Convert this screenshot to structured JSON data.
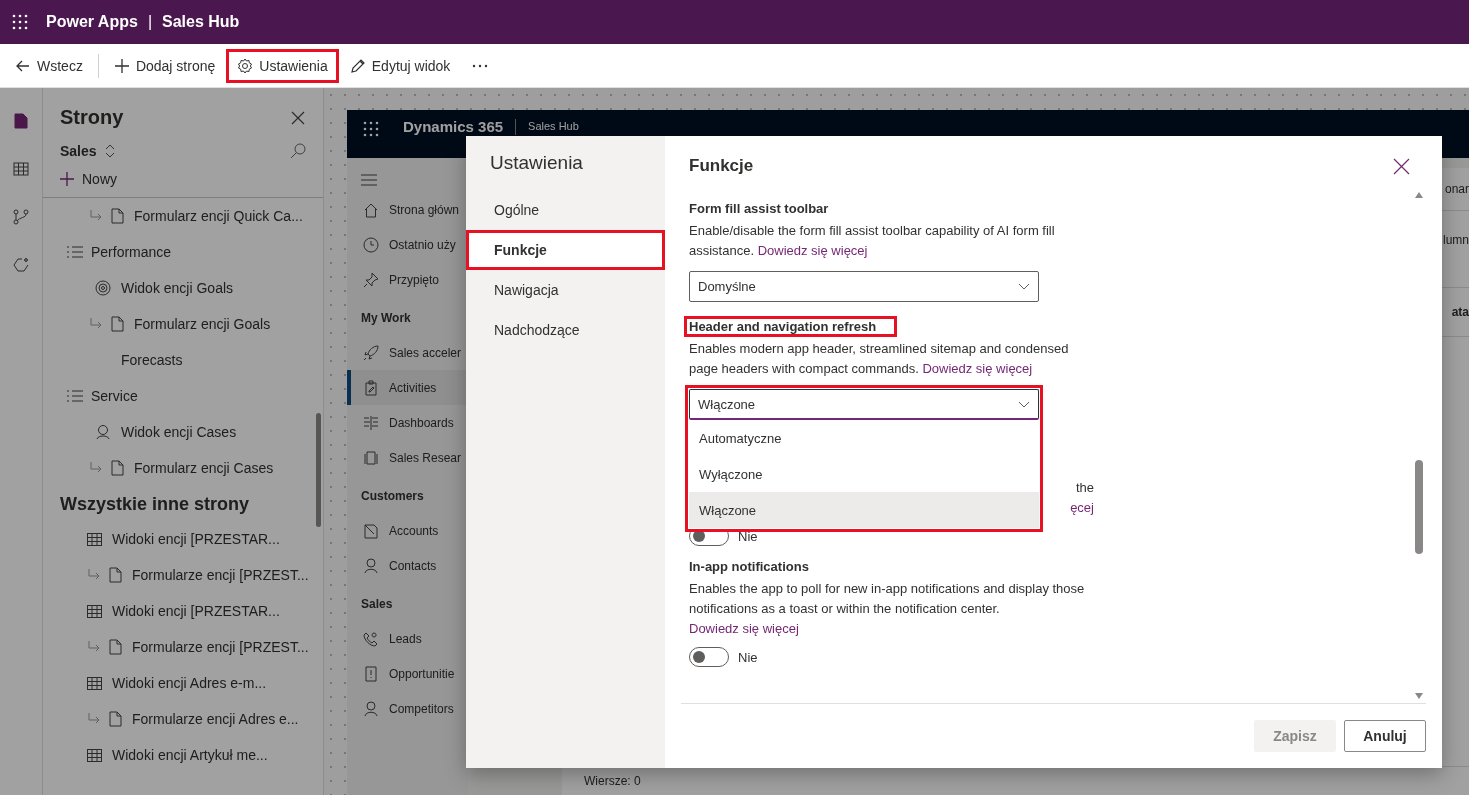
{
  "app_bar": {
    "title": "Power Apps",
    "separator": "|",
    "app": "Sales Hub"
  },
  "toolbar": [
    {
      "kind": "back",
      "label": "Wstecz",
      "highlighted": false
    },
    {
      "kind": "add",
      "label": "Dodaj stronę",
      "highlighted": false
    },
    {
      "kind": "settings",
      "label": "Ustawienia",
      "highlighted": true
    },
    {
      "kind": "edit",
      "label": "Edytuj widok",
      "highlighted": false
    },
    {
      "kind": "more",
      "highlighted": false
    }
  ],
  "rail": [
    {
      "kind": "page",
      "selected": true
    },
    {
      "kind": "table",
      "selected": false
    },
    {
      "kind": "flow",
      "selected": false
    },
    {
      "kind": "copilot",
      "selected": false
    }
  ],
  "pages_panel": {
    "title": "Strony",
    "area": "Sales",
    "new_button": "Nowy",
    "tree": [
      {
        "kind": "form",
        "label": "Formularz encji Quick Ca..."
      },
      {
        "kind": "group",
        "label": "Performance",
        "children": [
          {
            "kind": "target",
            "label": "Widok encji Goals"
          },
          {
            "kind": "form",
            "label": "Formularz encji Goals"
          },
          {
            "kind": "plain",
            "label": "Forecasts"
          }
        ]
      },
      {
        "kind": "group",
        "label": "Service",
        "children": [
          {
            "kind": "person",
            "label": "Widok encji Cases"
          },
          {
            "kind": "form",
            "label": "Formularz encji Cases"
          }
        ]
      }
    ],
    "other_title": "Wszystkie inne strony",
    "other": [
      {
        "kind": "grid",
        "label": "Widoki encji [PRZESTAR..."
      },
      {
        "kind": "form",
        "label": "Formularze encji [PRZEST..."
      },
      {
        "kind": "grid",
        "label": "Widoki encji [PRZESTAR..."
      },
      {
        "kind": "form",
        "label": "Formularze encji [PRZEST..."
      },
      {
        "kind": "grid",
        "label": "Widoki encji Adres e-m..."
      },
      {
        "kind": "form",
        "label": "Formularze encji Adres e..."
      },
      {
        "kind": "grid",
        "label": "Widoki encji Artykuł me..."
      }
    ]
  },
  "preview": {
    "brand": "Dynamics 365",
    "app": "Sales Hub",
    "nav": [
      {
        "kind": "menu"
      },
      {
        "kind": "home",
        "label": "Strona główn",
        "selected": false
      },
      {
        "kind": "clock",
        "label": "Ostatnio uży",
        "selected": false
      },
      {
        "kind": "pin",
        "label": "Przypięto",
        "selected": false
      },
      {
        "kind": "heading",
        "label": "My Work"
      },
      {
        "kind": "rocket",
        "label": "Sales acceler",
        "selected": false
      },
      {
        "kind": "clipboard",
        "label": "Activities",
        "selected": true
      },
      {
        "kind": "bars",
        "label": "Dashboards",
        "selected": false
      },
      {
        "kind": "pages",
        "label": "Sales Resear",
        "selected": false
      },
      {
        "kind": "heading",
        "label": "Customers"
      },
      {
        "kind": "folder",
        "label": "Accounts",
        "selected": false
      },
      {
        "kind": "person",
        "label": "Contacts",
        "selected": false
      },
      {
        "kind": "heading",
        "label": "Sales"
      },
      {
        "kind": "phone",
        "label": "Leads",
        "selected": false
      },
      {
        "kind": "alert",
        "label": "Opportunitie",
        "selected": false
      },
      {
        "kind": "person",
        "label": "Competitors",
        "selected": false
      }
    ],
    "fragments": [
      "onar",
      "lumn",
      "ata"
    ],
    "footer": "Wiersze: 0"
  },
  "dialog": {
    "title": "Ustawienia",
    "tabs": [
      {
        "label": "Ogólne",
        "selected": false,
        "highlighted": false
      },
      {
        "label": "Funkcje",
        "selected": true,
        "highlighted": true
      },
      {
        "label": "Nawigacja",
        "selected": false,
        "highlighted": false
      },
      {
        "label": "Nadchodzące",
        "selected": false,
        "highlighted": false
      }
    ],
    "heading": "Funkcje",
    "sections": [
      {
        "kind": "select",
        "title": "Form fill assist toolbar",
        "title_highlighted": false,
        "description": "Enable/disable the form fill assist toolbar capability of AI form fill assistance.",
        "link": "Dowiedz się więcej",
        "select": {
          "value": "Domyślne",
          "open": false,
          "highlighted": false
        }
      },
      {
        "kind": "select",
        "title": "Header and navigation refresh",
        "title_highlighted": true,
        "description": "Enables modern app header, streamlined sitemap and condensed page headers with compact commands.",
        "link": "Dowiedz się więcej",
        "select": {
          "value": "Włączone",
          "open": true,
          "highlighted": true,
          "options": [
            {
              "label": "Automatyczne",
              "selected": false
            },
            {
              "label": "Wyłączone",
              "selected": false
            },
            {
              "label": "Włączone",
              "selected": true
            }
          ]
        }
      },
      {
        "kind": "covered",
        "text": "the",
        "link": "ęcej",
        "toggle": {
          "on": false,
          "label": "Nie"
        }
      },
      {
        "kind": "toggle",
        "title": "In-app notifications",
        "description": "Enables the app to poll for new in-app notifications and display those notifications as a toast or within the notification center.",
        "link": "Dowiedz się więcej",
        "toggle": {
          "on": false,
          "label": "Nie"
        }
      }
    ],
    "buttons": [
      {
        "label": "Zapisz",
        "disabled": true
      },
      {
        "label": "Anuluj",
        "disabled": false
      }
    ]
  }
}
